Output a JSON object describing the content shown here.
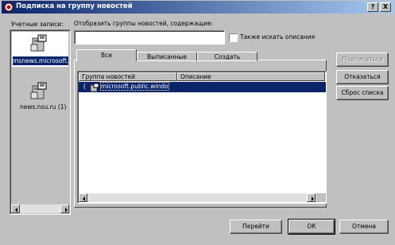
{
  "window": {
    "title": "Подписка на группу новостей",
    "help_button": "?",
    "close_button": "X"
  },
  "accounts": {
    "label": "Учетные записи:",
    "items": [
      {
        "label": "msnews.microsoft."
      },
      {
        "label": "news.nsu.ru (1)"
      }
    ]
  },
  "search": {
    "label": "Отобразить группы новостей, содержащие:",
    "value": "",
    "also_descriptions_label": "Также искать описания"
  },
  "tabs": [
    {
      "label": "Все"
    },
    {
      "label": "Выписанные"
    },
    {
      "label": "Создать"
    }
  ],
  "table": {
    "columns": [
      "Группа новостей",
      "Описание"
    ],
    "rows": [
      {
        "name": "microsoft.public.windo",
        "description": ""
      }
    ]
  },
  "side_buttons": {
    "subscribe": "Подписаться",
    "unsubscribe": "Отказаться",
    "reset": "Сброс списка"
  },
  "bottom_buttons": {
    "goto": "Перейти",
    "ok": "ОК",
    "cancel": "Отмена"
  }
}
